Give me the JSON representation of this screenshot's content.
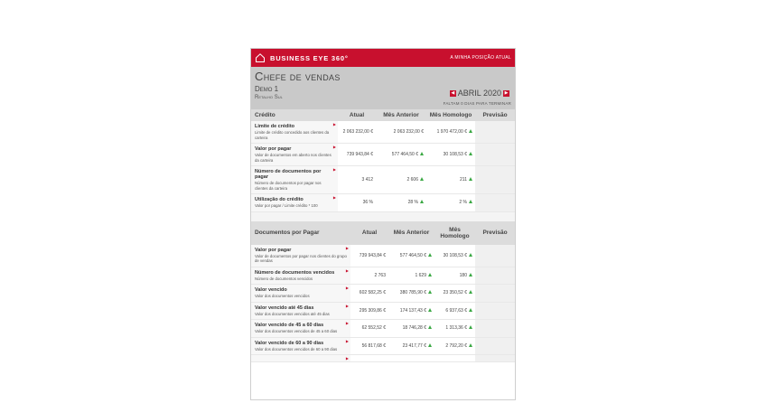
{
  "topbar": {
    "brand": "BUSINESS EYE 360°",
    "position_link": "A MINHA POSIÇÃO ATUAL"
  },
  "header": {
    "title": "Chefe de vendas",
    "demo": "Demo 1",
    "subtitle": "Retalho Sul",
    "month": "ABRIL 2020",
    "days_left": "FALTAM 0 DIAS PARA TERMINAR"
  },
  "credit_table": {
    "headers": [
      "Crédito",
      "Atual",
      "Mês Anterior",
      "Mês Homologo",
      "Previsão"
    ],
    "rows": [
      {
        "name": "Limite de crédito",
        "desc": "Limite de crédito concedido aos clientes da carteira",
        "atual": "2 063 232,00 €",
        "anterior": "2 063 232,00 €",
        "homologo": "1 970 472,00 €"
      },
      {
        "name": "Valor por pagar",
        "desc": "Valor de documentos em aberto nos clientes da carteira",
        "atual": "739 943,84 €",
        "anterior": "577 464,50 €",
        "homologo": "30 108,53 €"
      },
      {
        "name": "Número de documentos por pagar",
        "desc": "Número de documentos por pagar nos clientes da carteira",
        "atual": "3 412",
        "anterior": "2 606",
        "homologo": "211"
      },
      {
        "name": "Utilização do crédito",
        "desc": "Valor por pagar / Limite crédito * 100",
        "atual": "36 %",
        "anterior": "28 %",
        "homologo": "2 %"
      }
    ]
  },
  "docs_table": {
    "headers": [
      "Documentos por Pagar",
      "Atual",
      "Mês Anterior",
      "Mês Homologo",
      "Previsão"
    ],
    "rows": [
      {
        "name": "Valor por pagar",
        "desc": "Valor de documentos por pagar nos clientes do grupo de vendas",
        "atual": "739 943,84 €",
        "anterior": "577 464,50 €",
        "homologo": "30 108,53 €"
      },
      {
        "name": "Número de documentos vencidos",
        "desc": "Número de documentos vencidos",
        "atual": "2 763",
        "anterior": "1 629",
        "homologo": "180"
      },
      {
        "name": "Valor vencido",
        "desc": "Valor dos documentos vencidos",
        "atual": "602 582,25 €",
        "anterior": "380 785,90 €",
        "homologo": "23 350,52 €"
      },
      {
        "name": "Valor vencido até 45 dias",
        "desc": "Valor dos documentos vencidos até 45 dias",
        "atual": "295 309,86 €",
        "anterior": "174 137,43 €",
        "homologo": "6 937,63 €"
      },
      {
        "name": "Valor vencido de 45 a 60 dias",
        "desc": "Valor dos documentos vencidos de 45 a 60 dias",
        "atual": "62 552,52 €",
        "anterior": "18 746,28 €",
        "homologo": "1 313,36 €"
      },
      {
        "name": "Valor vencido de 60 a 90 dias",
        "desc": "Valor dos documentos vencidos de 60 a 90 dias",
        "atual": "56 817,68 €",
        "anterior": "23 417,77 €",
        "homologo": "2 792,20 €"
      },
      {
        "name": "",
        "desc": "",
        "atual": "",
        "anterior": "",
        "homologo": ""
      }
    ]
  },
  "colors": {
    "brand_red": "#c8102e",
    "trend_up": "#3aa843"
  },
  "icons": {
    "home": "home-icon",
    "prev": "chevron-left-icon",
    "next": "chevron-right-icon",
    "trend": "trend-up-icon"
  }
}
